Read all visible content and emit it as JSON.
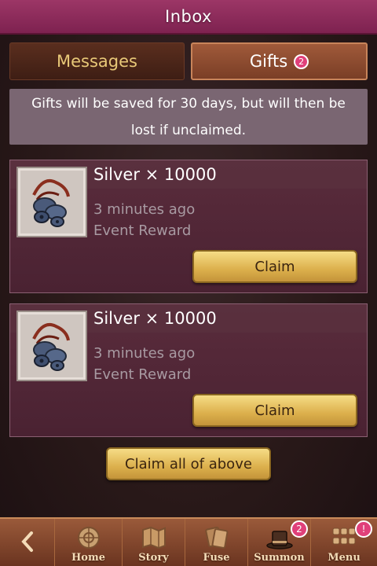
{
  "header": {
    "title": "Inbox"
  },
  "tabs": [
    {
      "label": "Messages",
      "active": false
    },
    {
      "label": "Gifts",
      "active": true,
      "badge": "2"
    }
  ],
  "notice": {
    "text": "Gifts will be saved for 30 days, but will then be lost if unclaimed."
  },
  "gifts": [
    {
      "title": "Silver × 10000",
      "time": "3 minutes ago",
      "source": "Event Reward",
      "claim_label": "Claim",
      "icon": "silver-coins-icon"
    },
    {
      "title": "Silver × 10000",
      "time": "3 minutes ago",
      "source": "Event Reward",
      "claim_label": "Claim",
      "icon": "silver-coins-icon"
    }
  ],
  "claim_all_label": "Claim all of above",
  "nav": {
    "back_icon": "back-arrow-icon",
    "items": [
      {
        "label": "Home",
        "icon": "home-icon"
      },
      {
        "label": "Story",
        "icon": "story-map-icon"
      },
      {
        "label": "Fuse",
        "icon": "fuse-cards-icon"
      },
      {
        "label": "Summon",
        "icon": "summon-hat-icon",
        "badge": "2"
      },
      {
        "label": "Menu",
        "icon": "menu-grid-icon",
        "badge": "!"
      }
    ]
  },
  "colors": {
    "header": "#8a2a5a",
    "gold_button": "#e6c064",
    "badge": "#e0407a",
    "card": "#4e2636"
  }
}
